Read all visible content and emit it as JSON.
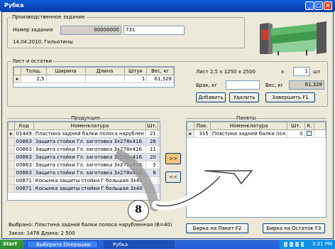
{
  "window": {
    "title": "Рубка"
  },
  "job": {
    "legend": "Производственное задание",
    "number_label": "Номер задания",
    "number_value": "00000000",
    "number_extra": "731",
    "date_line": "14.04.2010, Гильотины"
  },
  "sheet": {
    "legend": "Лист и остатки",
    "columns": [
      "Толщ.",
      "Ширина",
      "Длина",
      "Штук",
      "Вес, кг"
    ],
    "row": [
      "2,5",
      "",
      "",
      "1",
      "61,328"
    ],
    "desc": "Лист 2,5 x 1250 x 2500",
    "x_label": "x",
    "count_value": "1",
    "count_unit": "шт",
    "scrap_label": "Брак, кг",
    "weight_label": "Вес, кг",
    "weight_value": "61,328",
    "add_button": "Добавить",
    "delete_button": "Удалить",
    "finish_button": "Завершить   F1"
  },
  "products": {
    "title": "Продукция",
    "columns": [
      "Код",
      "Номенклатура",
      "Шт."
    ],
    "rows": [
      [
        "01449",
        "Пластина задней балки полоса нарублен",
        "21"
      ],
      [
        "00863",
        "Защита стойки Гл. заготовка 3х278х416.",
        "26"
      ],
      [
        "00863",
        "Защита стойки Гл. заготовка 3х278х416.",
        "11"
      ],
      [
        "00863",
        "Защита стойки Гл. заготовка 3х278х416.",
        "20"
      ],
      [
        "00863",
        "Защита стойки Гл. заготовка 3х278х416.",
        "5"
      ],
      [
        "00863",
        "Защита стойки Гл. заготовка 3х278х416.",
        "8"
      ],
      [
        "00871",
        "Косынка защиты стойки Г большая 3х40",
        ""
      ],
      [
        "00871",
        "Косынка защиты стойки Г большая 3х40",
        ""
      ]
    ],
    "selected_text": "Выбрано: Пластина задней балки полоса нарубленная (В=40)",
    "order_line": "Заказ: 1478  Длина: 2 500"
  },
  "transfer": {
    "add": ">>",
    "remove": "<<"
  },
  "packages": {
    "title": "Пакеты",
    "columns": [
      "Пак.",
      "Номенклатура",
      "Шт.",
      "К."
    ],
    "row": [
      "315",
      "Пластина задней балки пол",
      "0",
      ""
    ],
    "tag_package_button": "Бирка на Пакет   F2",
    "tag_remainder_button": "Бирка на Остаток  F3"
  },
  "annotation": {
    "number": "8"
  },
  "taskbar": {
    "start": "Start",
    "task1": "Выберите Операцию",
    "task2": "Рубка",
    "clock": "3:31 PM"
  }
}
